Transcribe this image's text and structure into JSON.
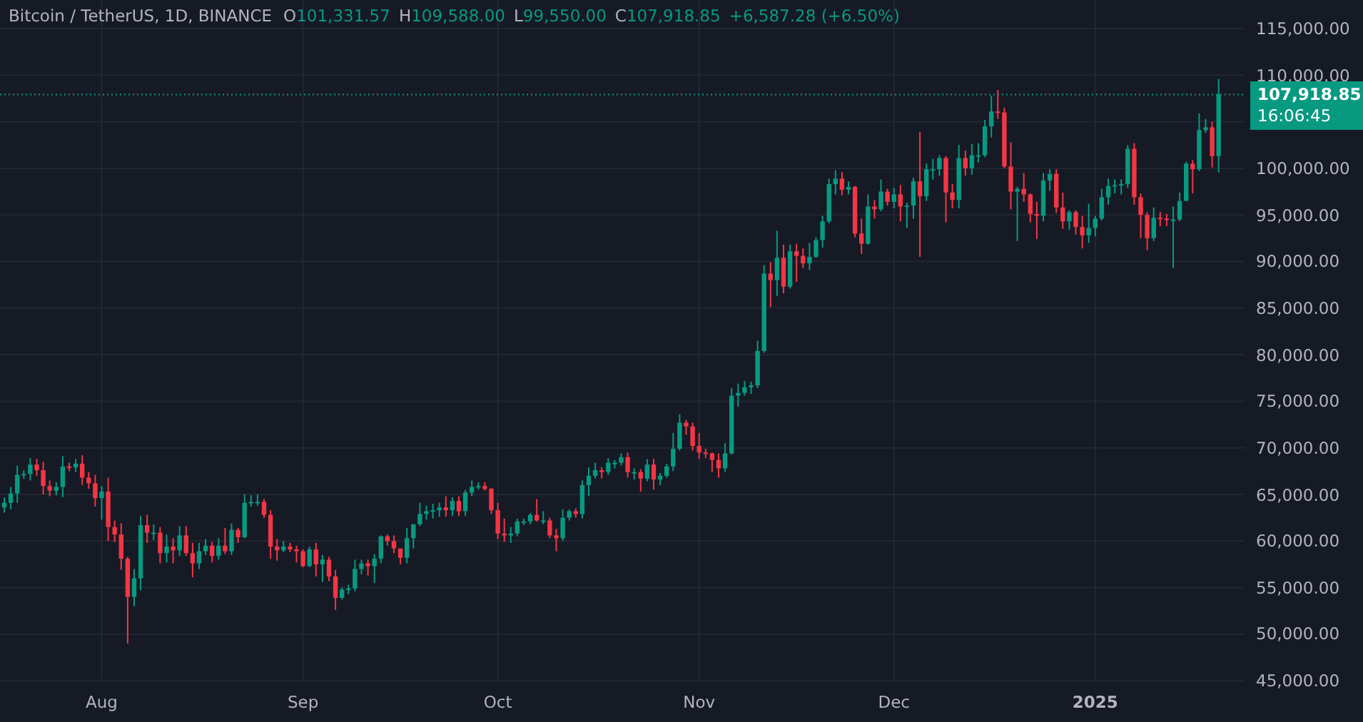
{
  "legend": {
    "symbol": "Bitcoin / TetherUS, 1D, BINANCE",
    "fields": [
      {
        "letter": "O",
        "value": "101,331.57"
      },
      {
        "letter": "H",
        "value": "109,588.00"
      },
      {
        "letter": "L",
        "value": "99,550.00"
      },
      {
        "letter": "C",
        "value": "107,918.85"
      }
    ],
    "change": "+6,587.28 (+6.50%)"
  },
  "price_label": {
    "price": "107,918.85",
    "countdown": "16:06:45"
  },
  "chart": {
    "chart_data": {
      "type": "candlestick",
      "grid": true,
      "ylim": [
        45000,
        115000
      ],
      "ref_lines": [
        {
          "axis": "y",
          "value": 107918.85,
          "color": "#089981"
        }
      ],
      "ohlc": [
        [
          63600,
          64650,
          63050,
          64100
        ],
        [
          64100,
          65800,
          63400,
          65100
        ],
        [
          65100,
          68100,
          64100,
          67100
        ],
        [
          67100,
          67600,
          66700,
          67200
        ],
        [
          67200,
          68900,
          66500,
          68200
        ],
        [
          68200,
          68800,
          67000,
          67600
        ],
        [
          67600,
          68500,
          65000,
          65900
        ],
        [
          65900,
          66500,
          64800,
          65400
        ],
        [
          65400,
          66300,
          64900,
          65800
        ],
        [
          65800,
          69100,
          64700,
          68000
        ],
        [
          68000,
          68400,
          67500,
          67900
        ],
        [
          67900,
          68800,
          67400,
          68300
        ],
        [
          68300,
          69200,
          66000,
          66800
        ],
        [
          66800,
          67400,
          65600,
          66200
        ],
        [
          66200,
          67100,
          63700,
          64600
        ],
        [
          64600,
          65900,
          62300,
          65300
        ],
        [
          65300,
          66800,
          60000,
          61500
        ],
        [
          61500,
          62200,
          59900,
          60700
        ],
        [
          60700,
          61900,
          56900,
          58100
        ],
        [
          58100,
          58300,
          49000,
          54000
        ],
        [
          54000,
          57000,
          53000,
          56000
        ],
        [
          56000,
          62700,
          54700,
          61700
        ],
        [
          61700,
          62800,
          59800,
          60900
        ],
        [
          60900,
          61800,
          60100,
          60900
        ],
        [
          60900,
          61500,
          57600,
          58700
        ],
        [
          58700,
          60700,
          57700,
          59400
        ],
        [
          59400,
          60300,
          57600,
          59000
        ],
        [
          59000,
          61600,
          58400,
          60600
        ],
        [
          60600,
          61600,
          58400,
          58700
        ],
        [
          58700,
          59800,
          56100,
          57600
        ],
        [
          57600,
          59800,
          57000,
          58900
        ],
        [
          58900,
          60200,
          58500,
          59500
        ],
        [
          59500,
          59900,
          57700,
          58400
        ],
        [
          58400,
          60300,
          58000,
          59500
        ],
        [
          59500,
          61400,
          58600,
          58900
        ],
        [
          58900,
          61900,
          58500,
          61200
        ],
        [
          61200,
          61400,
          59800,
          60400
        ],
        [
          60400,
          65000,
          60300,
          64100
        ],
        [
          64100,
          64900,
          63700,
          64200
        ],
        [
          64200,
          65000,
          63800,
          64200
        ],
        [
          64200,
          64500,
          62500,
          62800
        ],
        [
          62800,
          63300,
          58100,
          59400
        ],
        [
          59400,
          60200,
          57900,
          59000
        ],
        [
          59000,
          60000,
          58800,
          59400
        ],
        [
          59400,
          59800,
          58800,
          59100
        ],
        [
          59100,
          59500,
          57700,
          58900
        ],
        [
          58900,
          59100,
          57200,
          57300
        ],
        [
          57300,
          59400,
          57200,
          59100
        ],
        [
          59100,
          59800,
          56200,
          57500
        ],
        [
          57500,
          58500,
          55600,
          58000
        ],
        [
          58000,
          58300,
          55700,
          56200
        ],
        [
          56200,
          56900,
          52600,
          53900
        ],
        [
          53900,
          55000,
          53700,
          54800
        ],
        [
          54800,
          55300,
          54300,
          54900
        ],
        [
          54900,
          58000,
          54600,
          57000
        ],
        [
          57000,
          58000,
          56400,
          57600
        ],
        [
          57600,
          58000,
          56300,
          57300
        ],
        [
          57300,
          58600,
          55500,
          58100
        ],
        [
          58100,
          60600,
          57600,
          60500
        ],
        [
          60500,
          60700,
          59500,
          60000
        ],
        [
          60000,
          60600,
          58700,
          59200
        ],
        [
          59200,
          59200,
          57500,
          58200
        ],
        [
          58200,
          61400,
          57600,
          60300
        ],
        [
          60300,
          61800,
          59200,
          61800
        ],
        [
          61800,
          64100,
          61600,
          62900
        ],
        [
          62900,
          63800,
          62300,
          63200
        ],
        [
          63200,
          64000,
          62400,
          63300
        ],
        [
          63300,
          64100,
          62600,
          63600
        ],
        [
          63600,
          64800,
          62600,
          63300
        ],
        [
          63300,
          64700,
          62700,
          64300
        ],
        [
          64300,
          64800,
          62700,
          63200
        ],
        [
          63200,
          65500,
          62700,
          65200
        ],
        [
          65200,
          66500,
          64800,
          65800
        ],
        [
          65800,
          66300,
          65500,
          65900
        ],
        [
          65900,
          66300,
          65400,
          65600
        ],
        [
          65600,
          65700,
          62900,
          63300
        ],
        [
          63300,
          64100,
          60200,
          60800
        ],
        [
          60800,
          62400,
          59900,
          60600
        ],
        [
          60600,
          61500,
          59800,
          60800
        ],
        [
          60800,
          62400,
          60500,
          62100
        ],
        [
          62100,
          62400,
          61700,
          62100
        ],
        [
          62100,
          63000,
          61800,
          62800
        ],
        [
          62800,
          64500,
          62100,
          62200
        ],
        [
          62200,
          63200,
          61800,
          62200
        ],
        [
          62200,
          62500,
          60300,
          60600
        ],
        [
          60600,
          61300,
          58900,
          60300
        ],
        [
          60300,
          63400,
          60000,
          62500
        ],
        [
          62500,
          63400,
          62200,
          63200
        ],
        [
          63200,
          63500,
          62500,
          62900
        ],
        [
          62900,
          66500,
          62400,
          66000
        ],
        [
          66000,
          67900,
          64800,
          67000
        ],
        [
          67000,
          68400,
          66700,
          67600
        ],
        [
          67600,
          67900,
          66700,
          67400
        ],
        [
          67400,
          68900,
          67100,
          68400
        ],
        [
          68400,
          68700,
          67800,
          68400
        ],
        [
          68400,
          69400,
          68100,
          69000
        ],
        [
          69000,
          69500,
          66800,
          67400
        ],
        [
          67400,
          67800,
          66600,
          67400
        ],
        [
          67400,
          67700,
          65300,
          66700
        ],
        [
          66700,
          68800,
          66400,
          68200
        ],
        [
          68200,
          68800,
          65500,
          66600
        ],
        [
          66600,
          67300,
          66000,
          67000
        ],
        [
          67000,
          68300,
          66800,
          68000
        ],
        [
          68000,
          71600,
          67500,
          69900
        ],
        [
          69900,
          73600,
          69700,
          72700
        ],
        [
          72700,
          73000,
          71400,
          72300
        ],
        [
          72300,
          72700,
          69700,
          70200
        ],
        [
          70200,
          71600,
          68800,
          69500
        ],
        [
          69500,
          69900,
          68900,
          69400
        ],
        [
          69400,
          69500,
          67400,
          68700
        ],
        [
          68700,
          69400,
          66800,
          67800
        ],
        [
          67800,
          70500,
          67400,
          69400
        ],
        [
          69400,
          76400,
          69300,
          75600
        ],
        [
          75600,
          76900,
          74400,
          75900
        ],
        [
          75900,
          77200,
          75600,
          76500
        ],
        [
          76500,
          77100,
          75800,
          76700
        ],
        [
          76700,
          81500,
          76400,
          80400
        ],
        [
          80400,
          89600,
          80200,
          88700
        ],
        [
          88700,
          89900,
          85100,
          88000
        ],
        [
          88000,
          93300,
          86300,
          90400
        ],
        [
          90400,
          91800,
          86600,
          87300
        ],
        [
          87300,
          91800,
          87100,
          91100
        ],
        [
          91100,
          91900,
          87800,
          90600
        ],
        [
          90600,
          91400,
          89300,
          89800
        ],
        [
          89800,
          92000,
          89100,
          90500
        ],
        [
          90500,
          92600,
          90400,
          92300
        ],
        [
          92300,
          94900,
          91500,
          94300
        ],
        [
          94300,
          98900,
          94100,
          98300
        ],
        [
          98300,
          99800,
          97200,
          98900
        ],
        [
          98900,
          99600,
          97100,
          97700
        ],
        [
          97700,
          98600,
          97200,
          98000
        ],
        [
          98000,
          98100,
          92600,
          93000
        ],
        [
          93000,
          94600,
          90800,
          91900
        ],
        [
          91900,
          97200,
          91800,
          95900
        ],
        [
          95900,
          96600,
          94600,
          95600
        ],
        [
          95600,
          98800,
          95400,
          97500
        ],
        [
          97500,
          97800,
          96000,
          96400
        ],
        [
          96400,
          97900,
          95700,
          97200
        ],
        [
          97200,
          98200,
          94300,
          95900
        ],
        [
          95900,
          96300,
          93600,
          96000
        ],
        [
          96000,
          99000,
          94600,
          98600
        ],
        [
          98600,
          103900,
          90500,
          97000
        ],
        [
          97000,
          100500,
          96500,
          99900
        ],
        [
          99900,
          101000,
          98800,
          99900
        ],
        [
          99900,
          101400,
          99200,
          101100
        ],
        [
          101100,
          101300,
          94200,
          97400
        ],
        [
          97400,
          98300,
          95700,
          96600
        ],
        [
          96600,
          102500,
          95700,
          101100
        ],
        [
          101100,
          101900,
          99200,
          100000
        ],
        [
          100000,
          102600,
          99300,
          101400
        ],
        [
          101400,
          102700,
          100600,
          101400
        ],
        [
          101400,
          105200,
          101200,
          104500
        ],
        [
          104500,
          107800,
          103300,
          106100
        ],
        [
          106100,
          108400,
          105300,
          106000
        ],
        [
          106000,
          106500,
          100000,
          100200
        ],
        [
          100200,
          102800,
          95600,
          97500
        ],
        [
          97500,
          98000,
          92200,
          97800
        ],
        [
          97800,
          99500,
          96400,
          97200
        ],
        [
          97200,
          97300,
          94200,
          95100
        ],
        [
          95100,
          96400,
          92400,
          94900
        ],
        [
          94900,
          99500,
          94300,
          98700
        ],
        [
          98700,
          99900,
          97600,
          99400
        ],
        [
          99400,
          99900,
          95200,
          95800
        ],
        [
          95800,
          97400,
          93500,
          94300
        ],
        [
          94300,
          95500,
          93400,
          95300
        ],
        [
          95300,
          95500,
          92900,
          93700
        ],
        [
          93700,
          94900,
          91400,
          92800
        ],
        [
          92800,
          96200,
          92000,
          93600
        ],
        [
          93600,
          94900,
          92700,
          94600
        ],
        [
          94600,
          97800,
          94400,
          96900
        ],
        [
          96900,
          98900,
          96100,
          98100
        ],
        [
          98100,
          98800,
          97300,
          98200
        ],
        [
          98200,
          98800,
          97200,
          98300
        ],
        [
          98300,
          102500,
          97900,
          102100
        ],
        [
          102100,
          102700,
          96100,
          96900
        ],
        [
          96900,
          97300,
          92500,
          95000
        ],
        [
          95000,
          95300,
          91200,
          92500
        ],
        [
          92500,
          95800,
          92200,
          94700
        ],
        [
          94700,
          95300,
          93800,
          94600
        ],
        [
          94600,
          95100,
          93800,
          94500
        ],
        [
          94500,
          95900,
          89300,
          94500
        ],
        [
          94500,
          97400,
          94300,
          96500
        ],
        [
          96500,
          100700,
          96500,
          100500
        ],
        [
          100500,
          100900,
          97300,
          99900
        ],
        [
          99900,
          105900,
          99700,
          104100
        ],
        [
          104100,
          105300,
          103800,
          104400
        ],
        [
          104400,
          105000,
          100100,
          101300
        ],
        [
          101331.57,
          109588,
          99550,
          107918.85
        ]
      ],
      "categories": [
        null,
        null,
        null,
        null,
        null,
        null,
        null,
        null,
        null,
        null,
        null,
        null,
        null,
        null,
        null,
        "Aug",
        null,
        null,
        null,
        null,
        null,
        null,
        null,
        null,
        null,
        null,
        null,
        null,
        null,
        null,
        null,
        null,
        null,
        null,
        null,
        null,
        null,
        null,
        null,
        null,
        null,
        null,
        null,
        null,
        null,
        null,
        "Sep",
        null,
        null,
        null,
        null,
        null,
        null,
        null,
        null,
        null,
        null,
        null,
        null,
        null,
        null,
        null,
        null,
        null,
        null,
        null,
        null,
        null,
        null,
        null,
        null,
        null,
        null,
        null,
        null,
        null,
        "Oct",
        null,
        null,
        null,
        null,
        null,
        null,
        null,
        null,
        null,
        null,
        null,
        null,
        null,
        null,
        null,
        null,
        null,
        null,
        null,
        null,
        null,
        null,
        null,
        null,
        null,
        null,
        null,
        null,
        null,
        null,
        "Nov",
        null,
        null,
        null,
        null,
        null,
        null,
        null,
        null,
        null,
        null,
        null,
        null,
        null,
        null,
        null,
        null,
        null,
        null,
        null,
        null,
        null,
        null,
        null,
        null,
        null,
        null,
        null,
        null,
        null,
        "Dec",
        null,
        null,
        null,
        null,
        null,
        null,
        null,
        null,
        null,
        null,
        null,
        null,
        null,
        null,
        null,
        null,
        null,
        null,
        null,
        null,
        null,
        null,
        null,
        null,
        null,
        null,
        null,
        null,
        null,
        null,
        "2025",
        null,
        null,
        null,
        null,
        null,
        null,
        null,
        null,
        null,
        null,
        null,
        null,
        null,
        null,
        null,
        null,
        null,
        null,
        null
      ],
      "yticks": [
        {
          "value": 45000,
          "label": "45,000.00"
        },
        {
          "value": 50000,
          "label": "50,000.00"
        },
        {
          "value": 55000,
          "label": "55,000.00"
        },
        {
          "value": 60000,
          "label": "60,000.00"
        },
        {
          "value": 65000,
          "label": "65,000.00"
        },
        {
          "value": 70000,
          "label": "70,000.00"
        },
        {
          "value": 75000,
          "label": "75,000.00"
        },
        {
          "value": 80000,
          "label": "80,000.00"
        },
        {
          "value": 85000,
          "label": "85,000.00"
        },
        {
          "value": 90000,
          "label": "90,000.00"
        },
        {
          "value": 95000,
          "label": "95,000.00"
        },
        {
          "value": 100000,
          "label": "100,000.00"
        },
        {
          "value": 110000,
          "label": "110,000.00"
        },
        {
          "value": 115000,
          "label": "115,000.00"
        }
      ]
    }
  }
}
